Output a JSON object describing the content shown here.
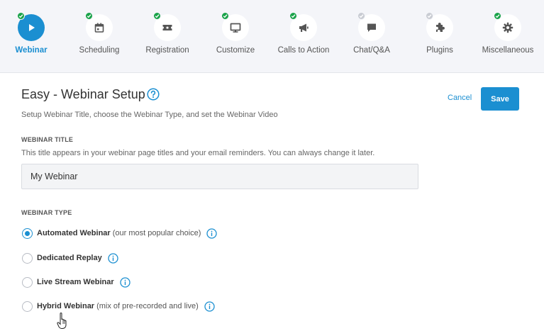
{
  "wizard": {
    "steps": [
      {
        "label": "Webinar",
        "icon": "play-icon",
        "status": "complete",
        "active": true
      },
      {
        "label": "Scheduling",
        "icon": "calendar-icon",
        "status": "complete",
        "active": false
      },
      {
        "label": "Registration",
        "icon": "ticket-icon",
        "status": "complete",
        "active": false
      },
      {
        "label": "Customize",
        "icon": "monitor-icon",
        "status": "complete",
        "active": false
      },
      {
        "label": "Calls to Action",
        "icon": "megaphone-icon",
        "status": "complete",
        "active": false
      },
      {
        "label": "Chat/Q&A",
        "icon": "chat-icon",
        "status": "pending",
        "active": false
      },
      {
        "label": "Plugins",
        "icon": "puzzle-icon",
        "status": "pending",
        "active": false
      },
      {
        "label": "Miscellaneous",
        "icon": "gear-icon",
        "status": "complete",
        "active": false
      }
    ],
    "colors": {
      "active": "#1b8fd1",
      "complete": "#1aa34a",
      "pending": "#c9ccd3"
    }
  },
  "header": {
    "title": "Easy - Webinar Setup",
    "subtitle": "Setup Webinar Title, choose the Webinar Type, and set the Webinar Video",
    "cancel_label": "Cancel",
    "save_label": "Save"
  },
  "webinar_title": {
    "label": "WEBINAR TITLE",
    "help": "This title appears in your webinar page titles and your email reminders. You can always change it later.",
    "value": "My Webinar"
  },
  "webinar_type": {
    "label": "WEBINAR TYPE",
    "options": [
      {
        "label": "Automated Webinar",
        "note": "(our most popular choice)",
        "checked": true
      },
      {
        "label": "Dedicated Replay",
        "note": "",
        "checked": false
      },
      {
        "label": "Live Stream Webinar",
        "note": "",
        "checked": false
      },
      {
        "label": "Hybrid Webinar",
        "note": "(mix of pre-recorded and live)",
        "checked": false
      }
    ]
  }
}
